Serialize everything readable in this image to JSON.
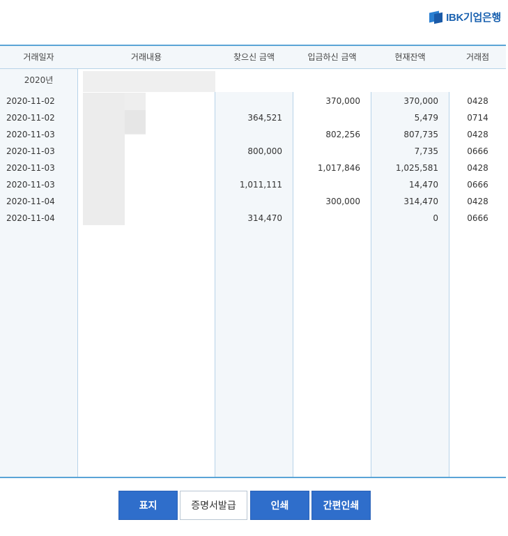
{
  "logo": {
    "mark_text": "IBK",
    "text": "IBK기업은행"
  },
  "table": {
    "headers": [
      "거래일자",
      "거래내용",
      "찾으신 금액",
      "입금하신 금액",
      "현재잔액",
      "거래점"
    ],
    "year_label": "2020년",
    "rows": [
      {
        "date": "2020-11-02",
        "desc": "",
        "withdrawal": "",
        "deposit": "370,000",
        "balance": "370,000",
        "branch": "0428"
      },
      {
        "date": "2020-11-02",
        "desc": "",
        "withdrawal": "364,521",
        "deposit": "",
        "balance": "5,479",
        "branch": "0714"
      },
      {
        "date": "2020-11-03",
        "desc": "",
        "withdrawal": "",
        "deposit": "802,256",
        "balance": "807,735",
        "branch": "0428"
      },
      {
        "date": "2020-11-03",
        "desc": "",
        "withdrawal": "800,000",
        "deposit": "",
        "balance": "7,735",
        "branch": "0666"
      },
      {
        "date": "2020-11-03",
        "desc": "",
        "withdrawal": "",
        "deposit": "1,017,846",
        "balance": "1,025,581",
        "branch": "0428"
      },
      {
        "date": "2020-11-03",
        "desc": "",
        "withdrawal": "1,011,111",
        "deposit": "",
        "balance": "14,470",
        "branch": "0666"
      },
      {
        "date": "2020-11-04",
        "desc": "",
        "withdrawal": "",
        "deposit": "300,000",
        "balance": "314,470",
        "branch": "0428"
      },
      {
        "date": "2020-11-04",
        "desc": "",
        "withdrawal": "314,470",
        "deposit": "",
        "balance": "0",
        "branch": "0666"
      }
    ]
  },
  "buttons": {
    "cover": "표지",
    "certificate": "증명서발급",
    "print": "인쇄",
    "simple_print": "간편인쇄"
  },
  "colors": {
    "accent": "#2f6ecb",
    "border": "#5aa4d6",
    "shade": "#f3f7fa"
  }
}
